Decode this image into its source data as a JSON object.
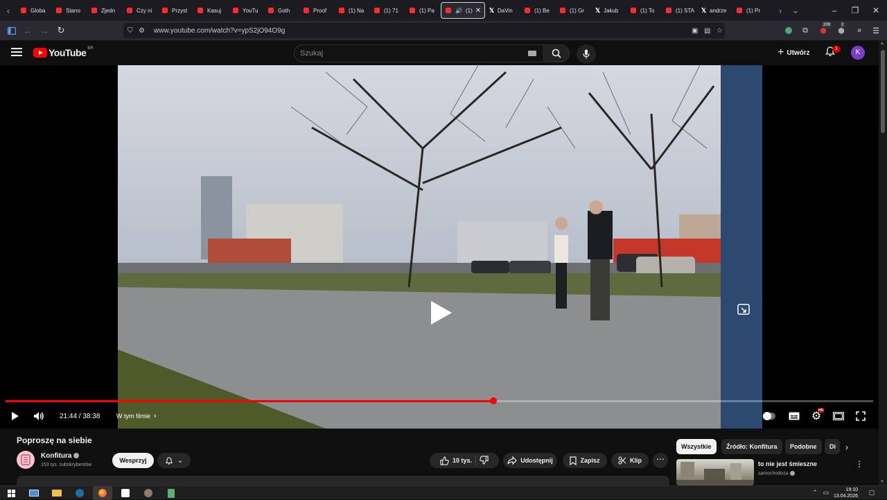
{
  "browser": {
    "tabs": [
      {
        "label": "Globa",
        "fav": "yt"
      },
      {
        "label": "Stano",
        "fav": "yt"
      },
      {
        "label": "Zjedn",
        "fav": "yt"
      },
      {
        "label": "Czy ni",
        "fav": "yt"
      },
      {
        "label": "Przyst",
        "fav": "yt"
      },
      {
        "label": "Kasuj",
        "fav": "yt"
      },
      {
        "label": "YouTu",
        "fav": "yt"
      },
      {
        "label": "Goth",
        "fav": "yt"
      },
      {
        "label": "Proof",
        "fav": "yt"
      },
      {
        "label": "(1) Na",
        "fav": "yt"
      },
      {
        "label": "(1) 71",
        "fav": "yt"
      },
      {
        "label": "(1) Pa",
        "fav": "yt"
      },
      {
        "label": "(1)",
        "fav": "yt",
        "active": true
      },
      {
        "label": "DaVin",
        "fav": "x"
      },
      {
        "label": "(1) Be",
        "fav": "yt"
      },
      {
        "label": "(1) Gr",
        "fav": "yt"
      },
      {
        "label": "Jakub",
        "fav": "x"
      },
      {
        "label": "(1) To",
        "fav": "yt"
      },
      {
        "label": "(1) STA",
        "fav": "yt"
      },
      {
        "label": "andrze",
        "fav": "x"
      },
      {
        "label": "(1) Pr",
        "fav": "yt"
      }
    ],
    "url": "www.youtube.com/watch?v=ypS2jO94O9g",
    "extensions": {
      "badge1": "209",
      "badge2": "2"
    },
    "accent": "#ff0000"
  },
  "youtube": {
    "logo_text": "YouTube",
    "logo_country": "BR",
    "search_placeholder": "Szukaj",
    "create_label": "Utwórz",
    "notifications_count": "1",
    "avatar_letter": "K",
    "avatar_color": "#7b3fc6"
  },
  "player": {
    "time": "21:44 / 38:38",
    "progress": 0.5626,
    "chapters_label": "W tym filmie",
    "settings_badge": "HD"
  },
  "video": {
    "title": "Poproszę na siebie",
    "channel": "Konfitura",
    "subscribers": "153 tys. subskrybentów",
    "support_label": "Wesprzyj",
    "likes": "10 tys.",
    "share_label": "Udostępnij",
    "save_label": "Zapisz",
    "clip_label": "Klip"
  },
  "sidebar": {
    "chips": [
      {
        "label": "Wszystkie",
        "selected": true
      },
      {
        "label": "Źródło: Konfitura",
        "selected": false
      },
      {
        "label": "Podobne",
        "selected": false
      },
      {
        "label": "Di",
        "selected": false
      }
    ],
    "recommendation": {
      "title": "to nie jest śmieszne",
      "channel": "samochodoza"
    }
  },
  "taskbar": {
    "time": "19:10",
    "date": "13.04.2026"
  }
}
